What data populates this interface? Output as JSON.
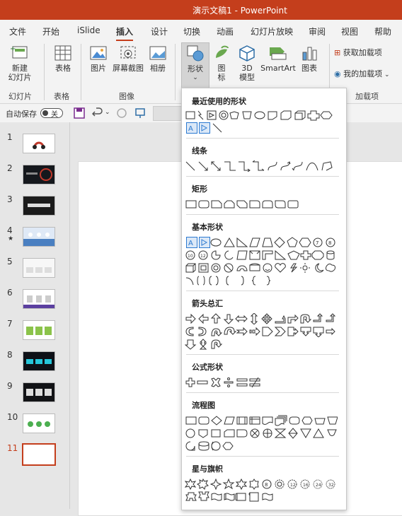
{
  "window": {
    "title": "演示文稿1  -  PowerPoint"
  },
  "tabs": [
    "文件",
    "开始",
    "iSlide",
    "插入",
    "设计",
    "切换",
    "动画",
    "幻灯片放映",
    "审阅",
    "视图",
    "帮助"
  ],
  "active_tab": "插入",
  "ribbon": {
    "new_slide": "新建\n幻灯片",
    "table": "表格",
    "image": "图片",
    "screenshot": "屏幕截图",
    "album": "相册",
    "shapes": "形状",
    "icons": "图\n标",
    "model3d": "3D\n模型",
    "smartart": "SmartArt",
    "chart": "图表",
    "get_addins": "获取加载项",
    "my_addins": "我的加载项",
    "groups": {
      "slides": "幻灯片",
      "tables": "表格",
      "images": "图像",
      "addins": "加载项"
    }
  },
  "qat": {
    "autosave": "自动保存",
    "toggle": "关"
  },
  "slides": [
    {
      "num": "1",
      "thumb": "#ffffff"
    },
    {
      "num": "2",
      "thumb": "#15181d"
    },
    {
      "num": "3",
      "thumb": "#1b1b1b"
    },
    {
      "num": "4",
      "thumb": "#dfe9f6",
      "star": "★"
    },
    {
      "num": "5",
      "thumb": "#f7f7f7"
    },
    {
      "num": "6",
      "thumb": "#ffffff"
    },
    {
      "num": "7",
      "thumb": "#ffffff"
    },
    {
      "num": "8",
      "thumb": "#0e1117"
    },
    {
      "num": "9",
      "thumb": "#121316"
    },
    {
      "num": "10",
      "thumb": "#ffffff"
    },
    {
      "num": "11",
      "thumb": "#ffffff"
    }
  ],
  "selected_slide": "11",
  "shapes_menu": {
    "recent": "最近使用的形状",
    "lines": "线条",
    "rect": "矩形",
    "basic": "基本形状",
    "arrows": "箭头总汇",
    "equation": "公式形状",
    "flowchart": "流程图",
    "stars": "星与旗帜"
  },
  "colors": {
    "accent": "#c43e1c",
    "highlight": "#2b79d0"
  }
}
